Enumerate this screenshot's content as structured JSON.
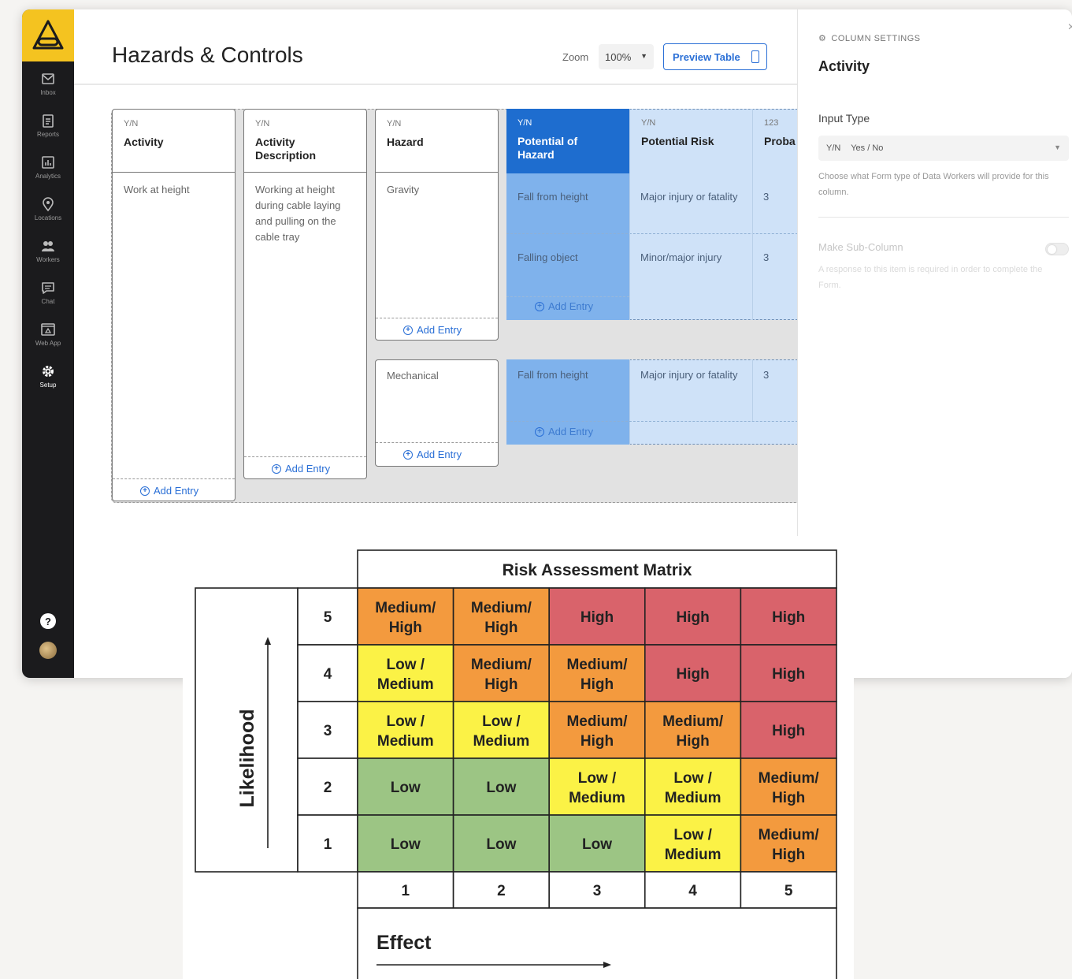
{
  "sidebar": {
    "nav": [
      {
        "label": "Inbox",
        "icon": "inbox-icon"
      },
      {
        "label": "Reports",
        "icon": "reports-icon"
      },
      {
        "label": "Analytics",
        "icon": "analytics-icon"
      },
      {
        "label": "Locations",
        "icon": "location-pin-icon"
      },
      {
        "label": "Workers",
        "icon": "workers-icon"
      },
      {
        "label": "Chat",
        "icon": "chat-icon"
      },
      {
        "label": "Web App",
        "icon": "web-app-icon"
      },
      {
        "label": "Setup",
        "icon": "gear-icon",
        "active": true
      }
    ],
    "help": "?"
  },
  "header": {
    "title": "Hazards & Controls",
    "zoom_label": "Zoom",
    "zoom_value": "100%",
    "preview_label": "Preview Table"
  },
  "table": {
    "add_entry": "Add Entry",
    "columns": [
      {
        "type": "Y/N",
        "name": "Activity"
      },
      {
        "type": "Y/N",
        "name": "Activity Description"
      },
      {
        "type": "Y/N",
        "name": "Hazard"
      },
      {
        "type": "Y/N",
        "name": "Potential of Hazard"
      },
      {
        "type": "Y/N",
        "name": "Potential Risk"
      },
      {
        "type": "123",
        "name": "Proba"
      }
    ],
    "activity": "Work at height",
    "description": "Working at height during cable laying and pulling on the cable tray",
    "hazards": [
      {
        "name": "Gravity",
        "rows": [
          {
            "potential": "Fall from height",
            "risk": "Major injury or fatality",
            "prob": "3"
          },
          {
            "potential": "Falling object",
            "risk": "Minor/major injury",
            "prob": "3"
          }
        ]
      },
      {
        "name": "Mechanical",
        "rows": [
          {
            "potential": "Fall from height",
            "risk": "Major injury or fatality",
            "prob": "3"
          }
        ]
      }
    ]
  },
  "settings": {
    "kicker": "COLUMN SETTINGS",
    "title": "Activity",
    "input_type_label": "Input Type",
    "input_type_tag": "Y/N",
    "input_type_value": "Yes / No",
    "input_type_help": "Choose what Form type of Data Workers will provide for this column.",
    "sub_column_label": "Make Sub-Column",
    "sub_column_help": "A response to this item is required in order to complete the Form.",
    "close": "×"
  },
  "chart_data": {
    "type": "heatmap",
    "title": "Risk Assessment Matrix",
    "xlabel": "Effect",
    "ylabel": "Likelihood",
    "x": [
      "1",
      "2",
      "3",
      "4",
      "5"
    ],
    "y": [
      "5",
      "4",
      "3",
      "2",
      "1"
    ],
    "cells": [
      [
        "Medium/ High",
        "Medium/ High",
        "High",
        "High",
        "High"
      ],
      [
        "Low / Medium",
        "Medium/ High",
        "Medium/ High",
        "High",
        "High"
      ],
      [
        "Low / Medium",
        "Low / Medium",
        "Medium/ High",
        "Medium/ High",
        "High"
      ],
      [
        "Low",
        "Low",
        "Low / Medium",
        "Low / Medium",
        "Medium/ High"
      ],
      [
        "Low",
        "Low",
        "Low",
        "Low / Medium",
        "Medium/ High"
      ]
    ],
    "colors": {
      "Low": "#9cc584",
      "Low / Medium": "#fbf246",
      "Medium/ High": "#f39a3e",
      "High": "#d9636b"
    }
  }
}
